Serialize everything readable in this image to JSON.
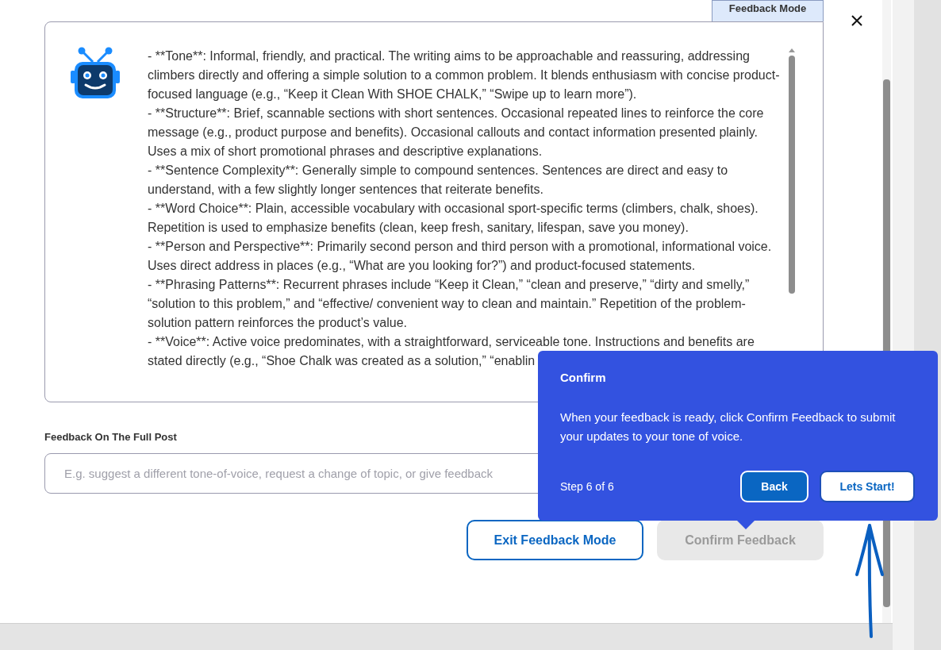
{
  "window": {
    "tab": "Feedback Mode"
  },
  "analysis": {
    "items": [
      "- **Tone**: Informal, friendly, and practical. The writing aims to be approachable and reassuring, addressing climbers directly and offering a simple solution to a common problem. It blends enthusiasm with concise product-focused language (e.g., “Keep it Clean With SHOE CHALK,” “Swipe up to learn more”).",
      "- **Structure**: Brief, scannable sections with short sentences. Occasional repeated lines to reinforce the core message (e.g., product purpose and benefits). Occasional callouts and contact information presented plainly. Uses a mix of short promotional phrases and descriptive explanations.",
      "- **Sentence Complexity**: Generally simple to compound sentences. Sentences are direct and easy to understand, with a few slightly longer sentences that reiterate benefits.",
      "- **Word Choice**: Plain, accessible vocabulary with occasional sport-specific terms (climbers, chalk, shoes). Repetition is used to emphasize benefits (clean, keep fresh, sanitary, lifespan, save you money).",
      "- **Person and Perspective**: Primarily second person and third person with a promotional, informational voice. Uses direct address in places (e.g., “What are you looking for?”) and product-focused statements.",
      "- **Phrasing Patterns**: Recurrent phrases include “Keep it Clean,” “clean and preserve,” “dirty and smelly,” “solution to this problem,” and “effective/ convenient way to clean and maintain.” Repetition of the problem-solution pattern reinforces the product’s value.",
      "- **Voice**: Active voice predominates, with a straightforward, serviceable tone. Instructions and benefits are stated directly (e.g., “Shoe Chalk was created as a solution,” “enablin"
    ]
  },
  "feedback": {
    "label": "Feedback On The Full Post",
    "placeholder": "E.g. suggest a different tone-of-voice, request a change of topic, or give feedback"
  },
  "buttons": [
    {
      "label": "Exit Feedback Mode",
      "kind": "outline",
      "disabled": false
    },
    {
      "label": "Confirm Feedback",
      "kind": "primary",
      "disabled": true
    }
  ],
  "tour": {
    "title": "Confirm",
    "body": "When your feedback is ready, click Confirm Feedback to submit your updates to your tone of voice.",
    "step": "Step 6 of 6",
    "buttons": [
      {
        "label": "Back",
        "kind": "back"
      },
      {
        "label": "Lets Start!",
        "kind": "next"
      }
    ]
  }
}
